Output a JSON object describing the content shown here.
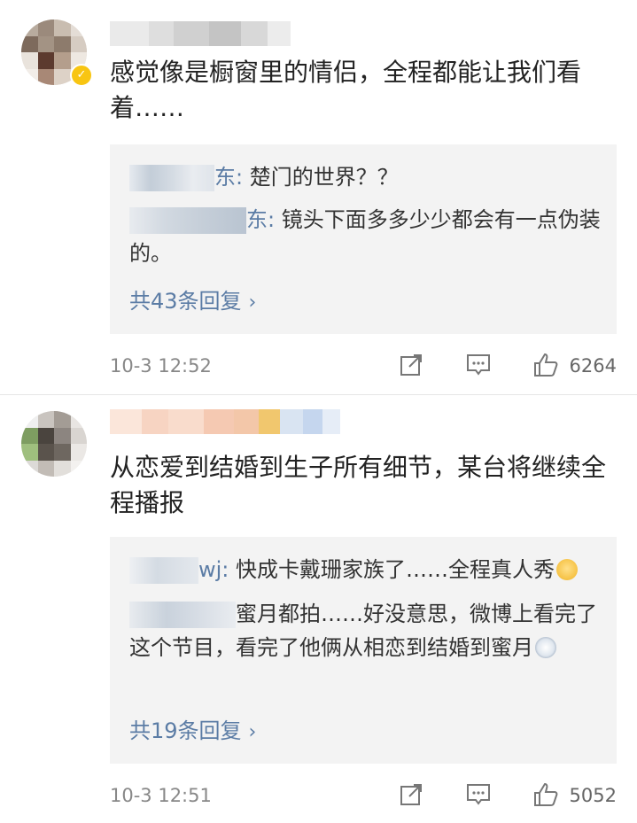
{
  "comments": [
    {
      "text": "感觉像是橱窗里的情侣，全程都能让我们看着……",
      "replies": [
        {
          "name_tail": "东:",
          "text": " 楚门的世界？？"
        },
        {
          "name_tail": "东:",
          "text": " 镜头下面多多少少都会有一点伪装的。"
        }
      ],
      "more_label": "共43条回复",
      "timestamp": "10-3 12:52",
      "likes": "6264",
      "icons": [
        "share-icon",
        "comment-icon",
        "thumbs-up-icon"
      ]
    },
    {
      "text": "从恋爱到结婚到生子所有细节，某台将继续全程播报",
      "replies": [
        {
          "name_tail": "wj:",
          "text": " 快成卡戴珊家族了……全程真人秀",
          "emoji": "shy-face-emoji"
        },
        {
          "name_tail": "",
          "text": "蜜月都拍……好没意思，微博上看完了这个节目，看完了他俩从相恋到结婚到蜜月",
          "emoji": "crying-face-emoji"
        }
      ],
      "more_label": "共19条回复",
      "timestamp": "10-3 12:51",
      "likes": "5052",
      "icons": [
        "share-icon",
        "comment-icon",
        "thumbs-up-icon"
      ]
    }
  ],
  "colors": {
    "link": "#5b7ca5",
    "reply_bg": "#f3f3f3",
    "meta": "#888888",
    "verified_badge": "#f8c512"
  }
}
